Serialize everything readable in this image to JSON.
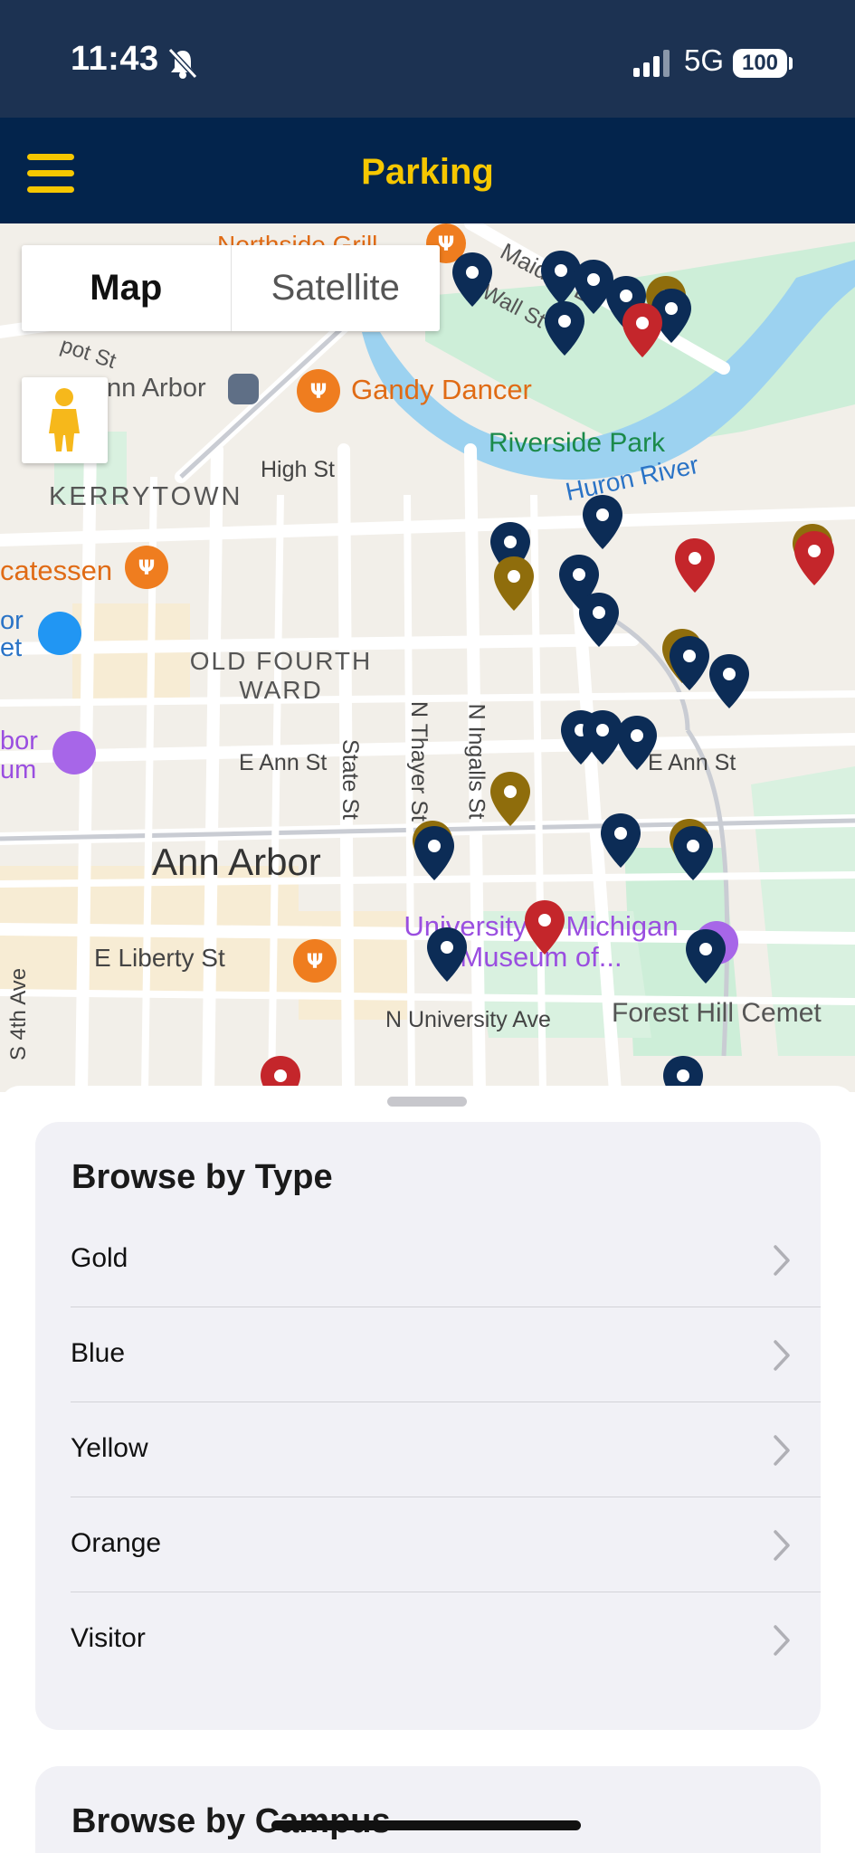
{
  "status_bar": {
    "time": "11:43",
    "network": "5G",
    "battery": "100"
  },
  "nav": {
    "title": "Parking"
  },
  "map": {
    "toggle": {
      "map_label": "Map",
      "satellite_label": "Satellite"
    },
    "labels": {
      "northside_grill": "Northside Grill",
      "maiden_lane": "Maiden Ln",
      "wall_st": "Wall St",
      "depot_st": "pot St",
      "ann_arbor_station": "nn Arbor",
      "gandy_dancer": "Gandy Dancer",
      "riverside_park": "Riverside Park",
      "high_st": "High St",
      "kerrytown": "KERRYTOWN",
      "huron_river": "Huron River",
      "delicatessen": "catessen",
      "old_fourth_ward": "OLD FOURTH WARD",
      "e_ann_st": "E Ann St",
      "e_ann_st_right": "E Ann St",
      "state_st": "State St",
      "n_thayer_st": "N Thayer St",
      "n_ingalls_st": "N Ingalls St",
      "ann_arbor": "Ann Arbor",
      "e_liberty_st": "E Liberty St",
      "university_of_michigan_museum": "University of Michigan Museum of...",
      "n_university_ave": "N University Ave",
      "forest_hill_cemetery": "Forest Hill Cemet",
      "s_4th_ave": "S 4th Ave",
      "for_et": "or et",
      "bor_um": "bor um"
    },
    "marker_colors": {
      "blue": "#0c2c56",
      "gold": "#8f6d0c",
      "red": "#c4262b",
      "white_dot": "#ffffff"
    }
  },
  "browse_by_type": {
    "title": "Browse by Type",
    "items": [
      "Gold",
      "Blue",
      "Yellow",
      "Orange",
      "Visitor"
    ]
  },
  "browse_by_campus": {
    "title": "Browse by Campus"
  },
  "colors": {
    "nav_background": "#03244c",
    "status_background": "#1c3252",
    "accent_maize": "#f6c700"
  }
}
